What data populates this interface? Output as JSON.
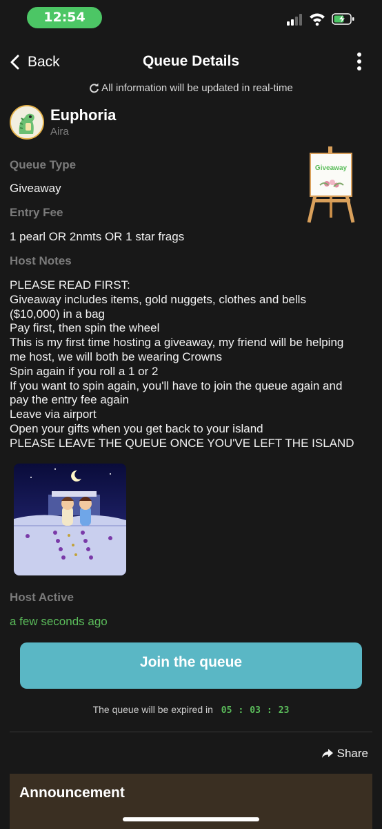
{
  "status_bar": {
    "time": "12:54",
    "time_pill_color": "#4cc665"
  },
  "nav": {
    "back_label": "Back",
    "title": "Queue Details"
  },
  "realtime_notice": "All information will be updated in real-time",
  "host": {
    "name": "Euphoria",
    "subtitle": "Aira"
  },
  "queue": {
    "type_label": "Queue Type",
    "type_value": "Giveaway",
    "fee_label": "Entry Fee",
    "fee_value": "1 pearl OR 2nmts OR 1 star frags",
    "notes_label": "Host Notes",
    "notes_lines": [
      "PLEASE READ FIRST:",
      "Giveaway includes items, gold nuggets, clothes and bells",
      "($10,000) in a bag",
      "Pay first, then spin the wheel",
      "This is my first time hosting a giveaway, my friend will be helping",
      "me host, we will both be wearing Crowns",
      "Spin again if you roll a 1 or 2",
      "If you want to spin again, you'll have to join the queue again and",
      "pay the entry fee again",
      "Leave via airport",
      "Open your gifts when you get back to your island",
      "PLEASE LEAVE THE QUEUE ONCE YOU'VE LEFT THE ISLAND"
    ],
    "easel_sign": "Giveaway",
    "active_label": "Host Active",
    "active_value": "a few seconds ago"
  },
  "join_button": "Join the queue",
  "expiry": {
    "text": "The queue will be expired in",
    "hours": "05",
    "minutes": "03",
    "seconds": "23",
    "separator": ":"
  },
  "share_label": "Share",
  "announcement_title": "Announcement",
  "colors": {
    "accent_button": "#5ab7c5",
    "active_green": "#5bbd5b",
    "background": "#181818",
    "announcement_bg": "#3a2f22"
  }
}
